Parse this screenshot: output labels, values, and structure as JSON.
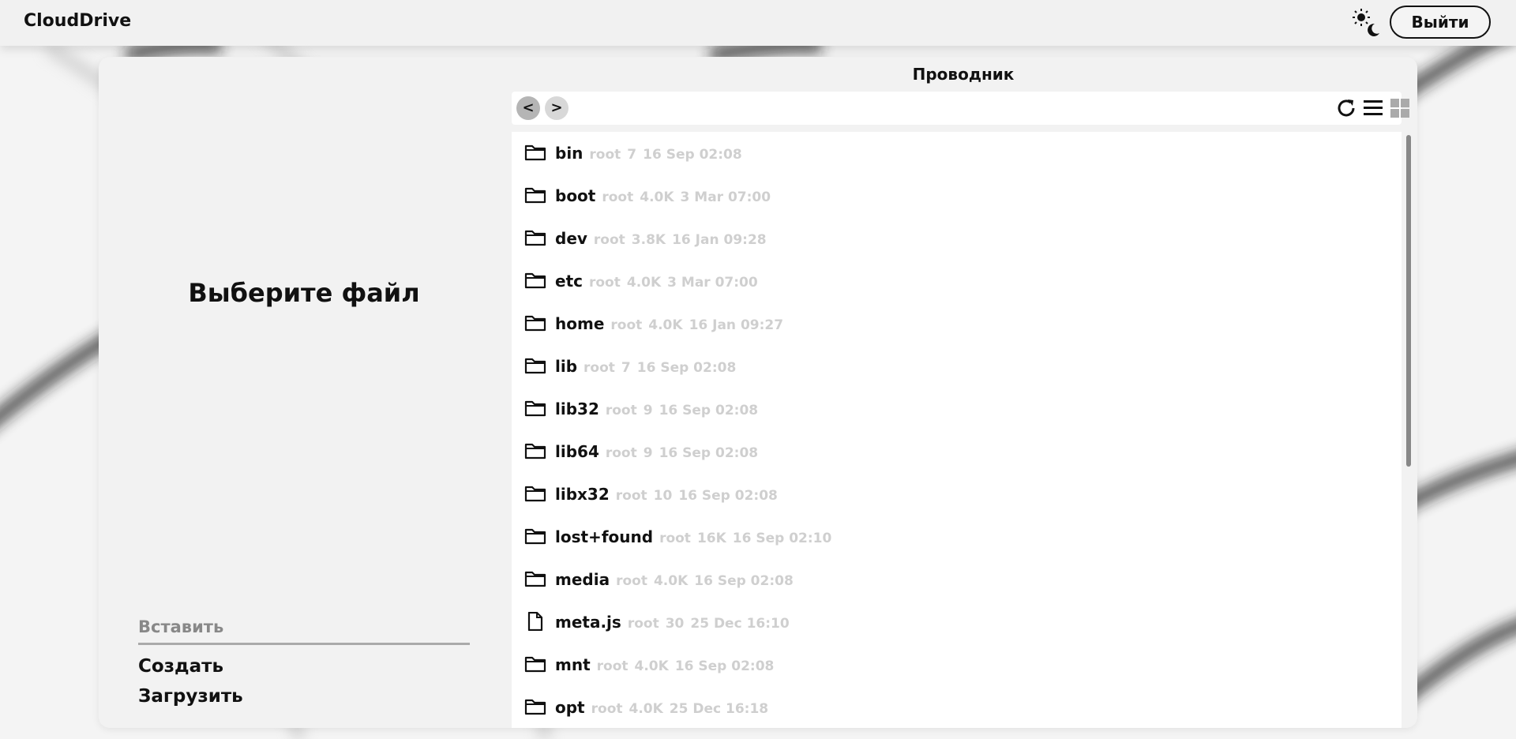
{
  "app": {
    "title": "CloudDrive"
  },
  "header": {
    "logout_label": "Выйти",
    "theme_icon": "sun-moon-icon"
  },
  "left": {
    "placeholder": "Выберите файл",
    "paste_label": "Вставить",
    "create_label": "Создать",
    "upload_label": "Загрузить"
  },
  "explorer": {
    "title": "Проводник",
    "back_label": "<",
    "forward_label": ">",
    "icons": [
      "refresh-icon",
      "list-view-icon",
      "grid-view-icon"
    ],
    "items": [
      {
        "name": "bin",
        "owner": "root",
        "size": "7",
        "date": "16 Sep 02:08",
        "type": "folder"
      },
      {
        "name": "boot",
        "owner": "root",
        "size": "4.0K",
        "date": "3 Mar 07:00",
        "type": "folder"
      },
      {
        "name": "dev",
        "owner": "root",
        "size": "3.8K",
        "date": "16 Jan 09:28",
        "type": "folder"
      },
      {
        "name": "etc",
        "owner": "root",
        "size": "4.0K",
        "date": "3 Mar 07:00",
        "type": "folder"
      },
      {
        "name": "home",
        "owner": "root",
        "size": "4.0K",
        "date": "16 Jan 09:27",
        "type": "folder"
      },
      {
        "name": "lib",
        "owner": "root",
        "size": "7",
        "date": "16 Sep 02:08",
        "type": "folder"
      },
      {
        "name": "lib32",
        "owner": "root",
        "size": "9",
        "date": "16 Sep 02:08",
        "type": "folder"
      },
      {
        "name": "lib64",
        "owner": "root",
        "size": "9",
        "date": "16 Sep 02:08",
        "type": "folder"
      },
      {
        "name": "libx32",
        "owner": "root",
        "size": "10",
        "date": "16 Sep 02:08",
        "type": "folder"
      },
      {
        "name": "lost+found",
        "owner": "root",
        "size": "16K",
        "date": "16 Sep 02:10",
        "type": "folder"
      },
      {
        "name": "media",
        "owner": "root",
        "size": "4.0K",
        "date": "16 Sep 02:08",
        "type": "folder"
      },
      {
        "name": "meta.js",
        "owner": "root",
        "size": "30",
        "date": "25 Dec 16:10",
        "type": "file"
      },
      {
        "name": "mnt",
        "owner": "root",
        "size": "4.0K",
        "date": "16 Sep 02:08",
        "type": "folder"
      },
      {
        "name": "opt",
        "owner": "root",
        "size": "4.0K",
        "date": "25 Dec 16:18",
        "type": "folder"
      }
    ]
  },
  "colors": {
    "background": "#f4f4f4",
    "panel": "#f2f2f2",
    "meta_text": "#cfcfcf",
    "accent": "#111111"
  }
}
